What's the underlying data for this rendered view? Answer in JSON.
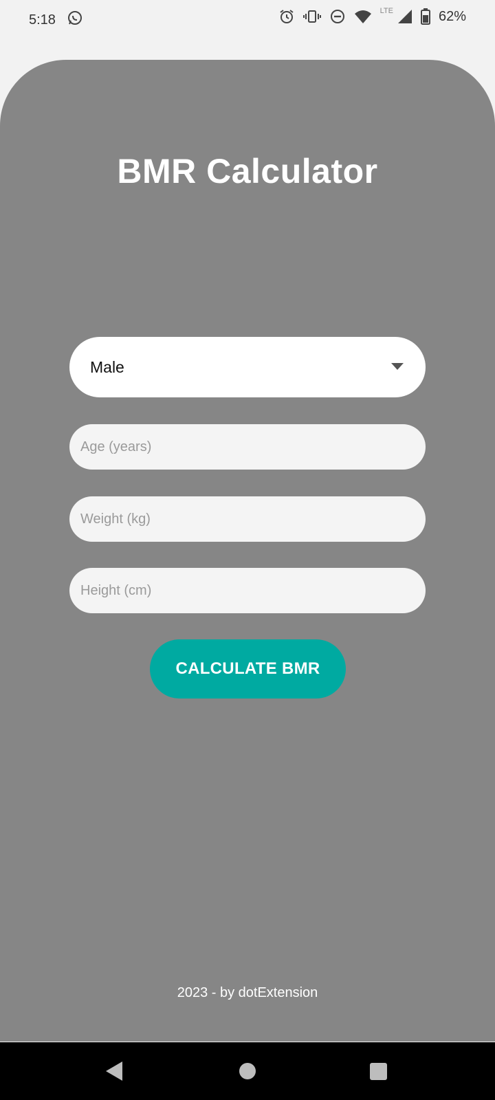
{
  "status_bar": {
    "time": "5:18",
    "network": "LTE",
    "battery": "62%",
    "icons": [
      "whatsapp-icon",
      "alarm-icon",
      "vibrate-icon",
      "do-not-disturb-icon",
      "wifi-icon",
      "cell-signal-icon",
      "battery-icon"
    ]
  },
  "app": {
    "title": "BMR Calculator"
  },
  "form": {
    "gender": {
      "value": "Male",
      "icon": "dropdown-arrow-icon"
    },
    "age": {
      "placeholder": "Age (years)",
      "value": ""
    },
    "weight": {
      "placeholder": "Weight (kg)",
      "value": ""
    },
    "height": {
      "placeholder": "Height (cm)",
      "value": ""
    },
    "calculate_label": "CALCULATE BMR"
  },
  "footer": {
    "text": "2023 - by dotExtension"
  },
  "colors": {
    "background": "#868686",
    "accent": "#00aaa1",
    "status_bar_bg": "#f2f2f2",
    "nav_bar_bg": "#000000"
  },
  "nav_bar": {
    "icons": [
      "back-icon",
      "home-icon",
      "recents-icon"
    ]
  }
}
